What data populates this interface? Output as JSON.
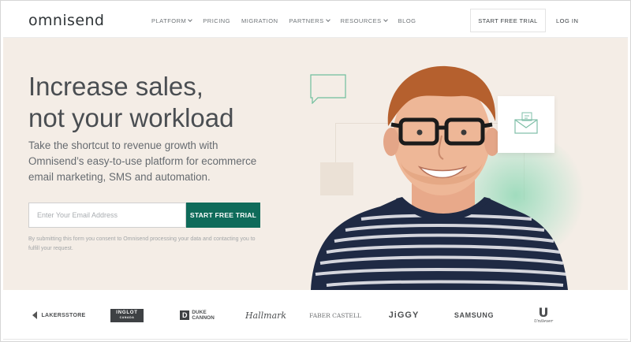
{
  "header": {
    "logo": "omnisend",
    "nav": [
      {
        "label": "PLATFORM",
        "has_dropdown": true
      },
      {
        "label": "PRICING",
        "has_dropdown": false
      },
      {
        "label": "MIGRATION",
        "has_dropdown": false
      },
      {
        "label": "PARTNERS",
        "has_dropdown": true
      },
      {
        "label": "RESOURCES",
        "has_dropdown": true
      },
      {
        "label": "BLOG",
        "has_dropdown": false
      }
    ],
    "cta_label": "START FREE TRIAL",
    "login_label": "LOG IN"
  },
  "hero": {
    "headline_line1": "Increase sales,",
    "headline_line2": "not your workload",
    "subtext": "Take the shortcut to revenue growth with Omnisend’s easy-to-use platform for ecommerce email marketing, SMS and automation.",
    "email_placeholder": "Enter Your Email Address",
    "cta_label": "START FREE TRIAL",
    "consent": "By submitting this form you consent to Omnisend processing your data and contacting you to fulfill your request."
  },
  "logos": {
    "lakers": "LAKERSSTORE",
    "inglot_line1": "INGLOT",
    "inglot_line2": "CANADA",
    "duke_mark": "D",
    "duke_line1": "DUKE",
    "duke_line2": "CANNON",
    "hallmark": "Hallmark",
    "faber": "FABER CASTELL",
    "jiggy": "JiGGY",
    "samsung": "SAMSUNG",
    "unilever_mark": "U",
    "unilever": "Unilever"
  },
  "colors": {
    "accent": "#0f6b5a",
    "hero_bg": "#f4ede6",
    "glow": "#84d6b0",
    "text_dark": "#4a4e52"
  },
  "icons": [
    "chat-bubble-icon",
    "mail-icon",
    "chevron-down-icon"
  ]
}
